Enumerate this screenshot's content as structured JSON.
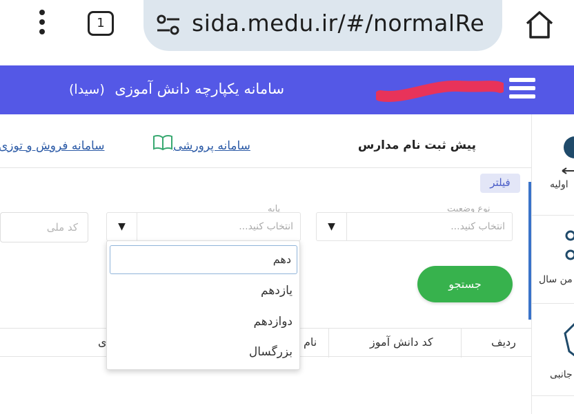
{
  "browser": {
    "tab_count": "1",
    "url": "sida.medu.ir/#/normalRe"
  },
  "app": {
    "title": "سامانه یکپارچه دانش آموزی",
    "title_abbr": "(سیدا)",
    "header_color": "#5458e6"
  },
  "sidebar": {
    "items": [
      {
        "label": "اولیه"
      },
      {
        "label": "من سال"
      },
      {
        "label": "جانبی"
      }
    ]
  },
  "links": {
    "pre_enrollment": "پیش ثبت نام مدارس",
    "upbringing": "سامانه پرورشی",
    "sales": "سامانه فروش و توزی"
  },
  "filter": {
    "badge": "فیلتر",
    "status_label": "نوع وضعیت",
    "status_placeholder": "انتخاب کنید...",
    "grade_label": "پایه",
    "grade_placeholder": "انتخاب کنید...",
    "national_code_placeholder": "کد ملی",
    "search_button": "جستجو",
    "arrow": "▼"
  },
  "dropdown": {
    "search_value": "دهم",
    "options": [
      "یازدهم",
      "دوازدهم",
      "بزرگسال"
    ]
  },
  "table": {
    "headers": [
      "ردیف",
      "کد دانش آموز",
      "نام",
      "ی"
    ]
  }
}
